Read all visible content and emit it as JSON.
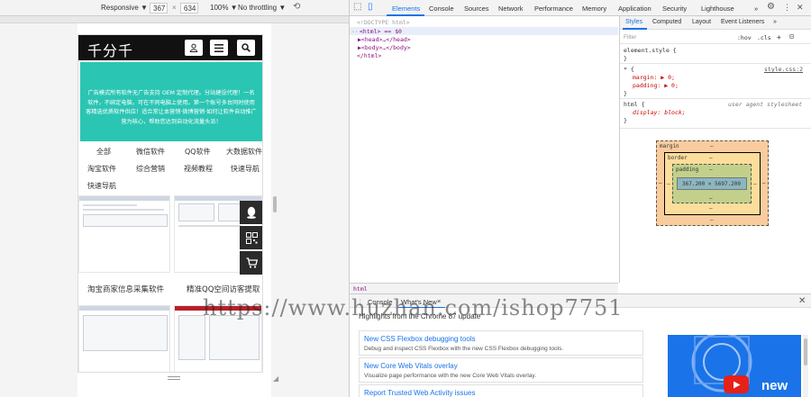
{
  "device_toolbar": {
    "device": "Responsive ▼",
    "width": "367",
    "times": "×",
    "height": "634",
    "zoom": "100% ▼",
    "throttle": "No throttling ▼"
  },
  "mobile": {
    "logo": "千分千",
    "banner_text": "广告模式所有软件无广告支持 OEM 定制代理。分站建设代理！一名\n软件，不绑定电脑，可在不同电脑上使用。第一个账号多台同时使用\n客精选优质软件供应！适合常让本营销·微博营销·如何让软件自动推广\n营为核心，帮助您达到自动化流量头派！",
    "categories": [
      "全部",
      "微信软件",
      "QQ软件",
      "大数据软件",
      "淘宝软件",
      "综合营销",
      "视频教程",
      "快速导航",
      "快速导航"
    ],
    "products": [
      "淘宝商家信息采集软件",
      "精准QQ空间访客提取"
    ]
  },
  "devtools": {
    "tabs": [
      "Elements",
      "Console",
      "Sources",
      "Network",
      "Performance",
      "Memory",
      "Application",
      "Security",
      "Lighthouse"
    ],
    "more": "»",
    "dom": {
      "doctype": "<!DOCTYPE html>",
      "html_line": "<html> == $0",
      "head": "▶<head>…</head>",
      "body": "▶<body>…</body>",
      "html_close": "</html>"
    },
    "styles": {
      "tabs": [
        "Styles",
        "Computed",
        "Layout",
        "Event Listeners",
        "»"
      ],
      "filter_placeholder": "Filter",
      "hov": ":hov",
      "cls": ".cls",
      "plus": "+",
      "element_style": "element.style {",
      "close_brace": "}",
      "rule1_selector": "* {",
      "rule1_source": "style.css:2",
      "rule1_p1": "margin: ▶ 0;",
      "rule1_p2": "padding: ▶ 0;",
      "rule2_selector": "html {",
      "rule2_source": "user agent stylesheet",
      "rule2_p1": "display: block;",
      "box": {
        "margin": "margin",
        "border": "border",
        "padding": "padding",
        "dash": "–",
        "content": "367.200 × 5697.200"
      }
    },
    "breadcrumb": "html",
    "drawer": {
      "tabs": [
        "Console",
        "What's New"
      ],
      "close_tab": "×",
      "heading": "Highlights from the Chrome 87 update",
      "items": [
        {
          "title": "New CSS Flexbox debugging tools",
          "desc": "Debug and inspect CSS Flexbox with the new CSS Flexbox debugging tools."
        },
        {
          "title": "New Core Web Vitals overlay",
          "desc": "Visualize page performance with the new Core Web Vitals overlay."
        },
        {
          "title": "Report Trusted Web Activity issues",
          "desc": ""
        }
      ],
      "video_label": "new"
    }
  },
  "watermark": "https://www.huzhan.com/ishop7751"
}
